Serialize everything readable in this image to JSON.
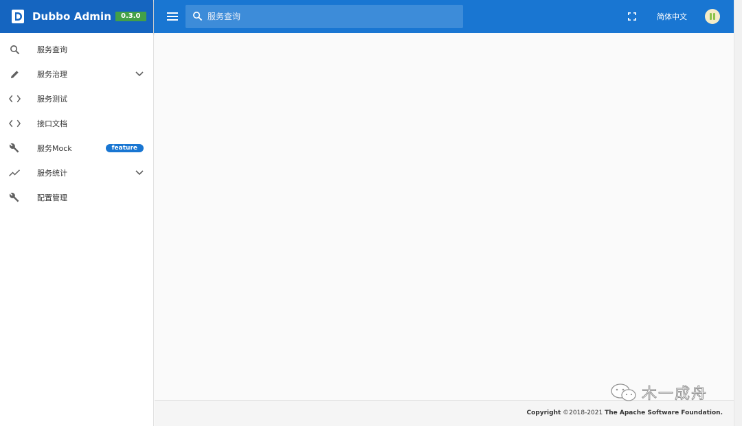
{
  "app": {
    "title": "Dubbo Admin",
    "version": "0.3.0",
    "brand_color": "#1565c0",
    "topbar_color": "#1976d2"
  },
  "sidebar": {
    "items": [
      {
        "label": "服务查询",
        "icon": "search-icon",
        "expandable": false
      },
      {
        "label": "服务治理",
        "icon": "pencil-icon",
        "expandable": true
      },
      {
        "label": "服务测试",
        "icon": "code-icon",
        "expandable": false
      },
      {
        "label": "接口文档",
        "icon": "code-icon",
        "expandable": false
      },
      {
        "label": "服务Mock",
        "icon": "wrench-icon",
        "expandable": false,
        "badge": "feature"
      },
      {
        "label": "服务统计",
        "icon": "trending-up-icon",
        "expandable": true
      },
      {
        "label": "配置管理",
        "icon": "wrench-icon",
        "expandable": false
      }
    ]
  },
  "topbar": {
    "search_placeholder": "服务查询",
    "language": "简体中文"
  },
  "footer": {
    "copyright_label": "Copyright",
    "copyright_years": "©2018-2021",
    "organization": "The Apache Software Foundation."
  },
  "watermark": {
    "text": "木一成舟"
  }
}
